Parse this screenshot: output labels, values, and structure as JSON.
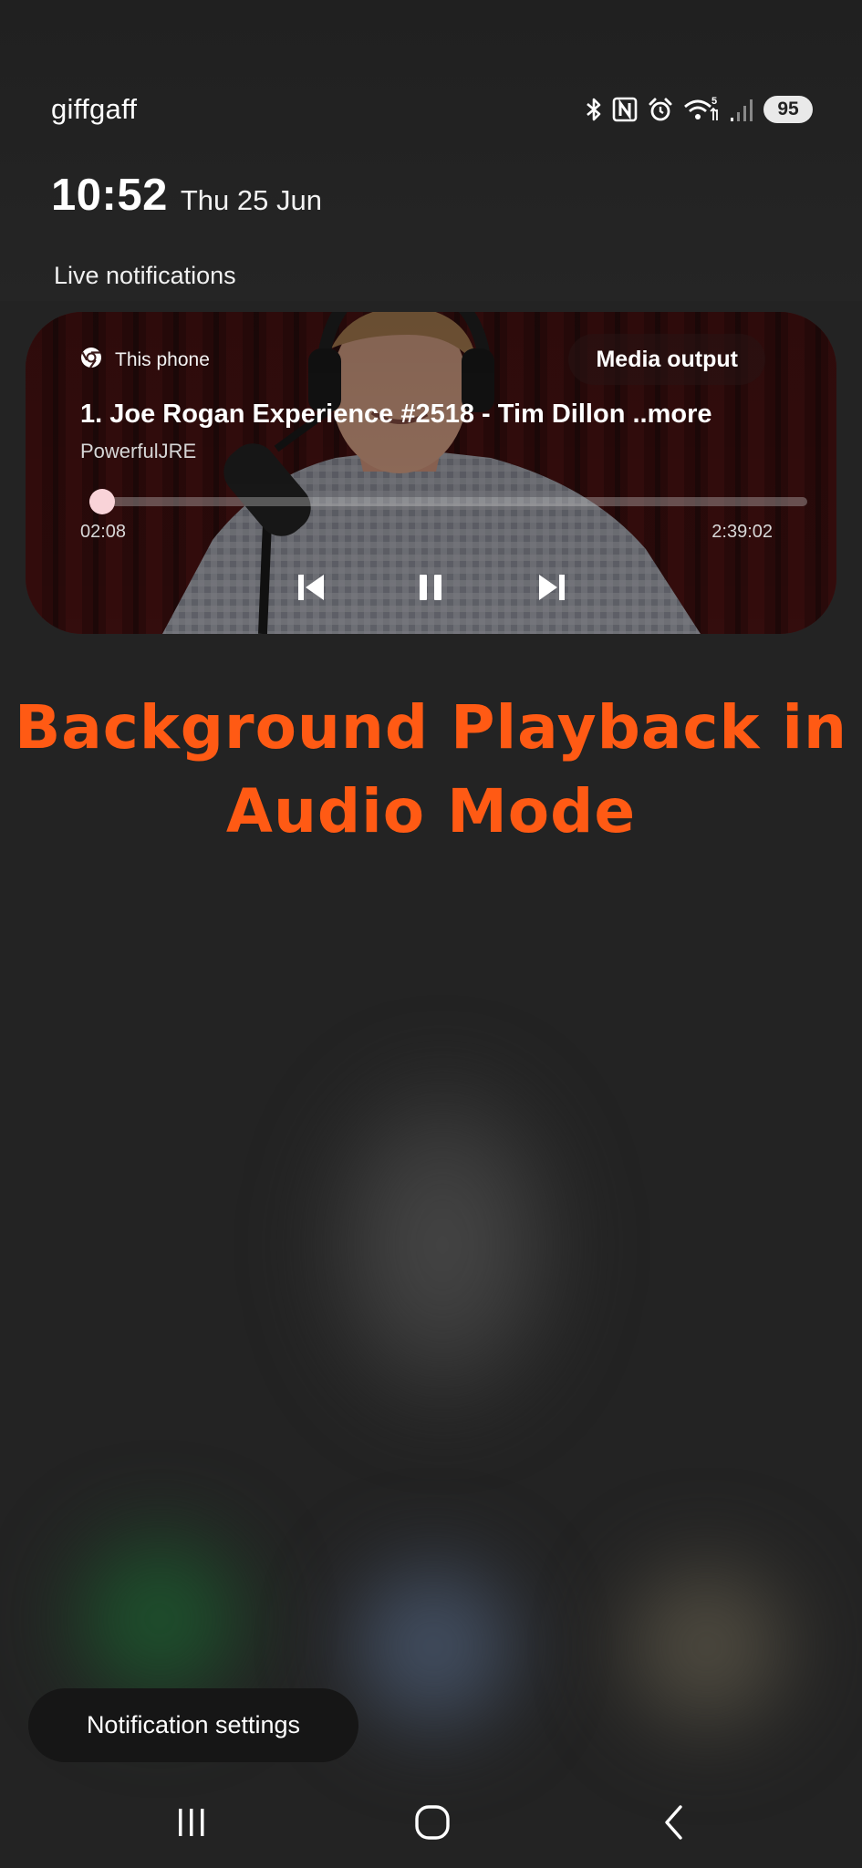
{
  "status_bar": {
    "carrier": "giffgaff",
    "battery": "95",
    "icons": [
      "bluetooth-icon",
      "nfc-icon",
      "alarm-icon",
      "wifi-5-icon",
      "signal-icon"
    ]
  },
  "clock": {
    "time": "10:52",
    "date": "Thu 25 Jun"
  },
  "notifications": {
    "section_label": "Live notifications"
  },
  "media": {
    "source": "This phone",
    "source_icon": "chrome-icon",
    "output_button": "Media output",
    "title": "1. Joe Rogan Experience #2518 - Tim Dillon ..more",
    "artist": "PowerfulJRE",
    "elapsed": "02:08",
    "total": "2:39:02",
    "progress_fraction": 0.013,
    "controls": [
      "previous-icon",
      "pause-icon",
      "next-icon"
    ],
    "accent_color": "#f6c8cf"
  },
  "promo": {
    "line1": "Background Playback in",
    "line2": "Audio Mode",
    "color": "#ff5a14"
  },
  "footer": {
    "settings_label": "Notification settings"
  },
  "nav": {
    "icons": [
      "recents-icon",
      "home-icon",
      "back-icon"
    ]
  }
}
